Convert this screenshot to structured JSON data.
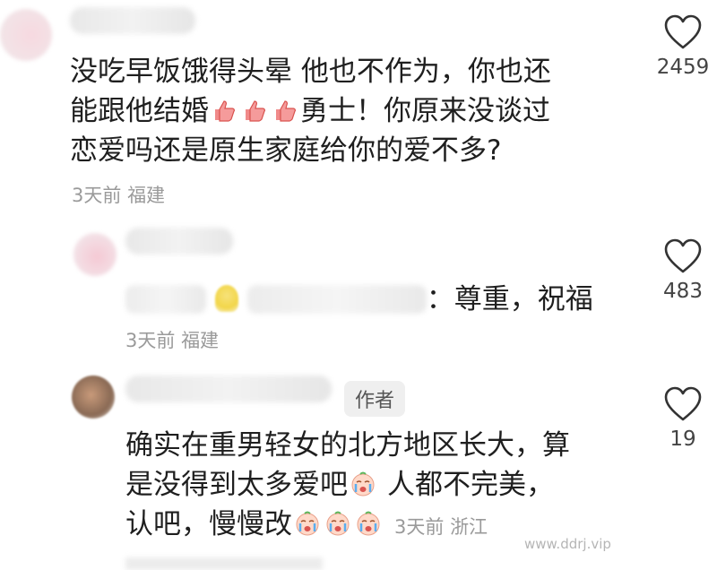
{
  "comments": [
    {
      "line1": "没吃早饭饿得头晕 他也不作为，你也还",
      "line2_a": "能跟他结婚",
      "line2_b": "勇士！你原来没谈过",
      "line3": "恋爱吗还是原生家庭给你的爱不多?",
      "time": "3天前",
      "location": "福建",
      "likes": "2459"
    },
    {
      "text_visible": "尊重，祝福",
      "text_visible_prefix": "：",
      "time": "3天前",
      "location": "福建",
      "likes": "483"
    },
    {
      "badge": "作者",
      "line1": "确实在重男轻女的北方地区长大，算",
      "line2_a": "是没得到太多爱吧",
      "line2_b": "人都不完美，",
      "line3": "认吧，慢慢改",
      "time": "3天前",
      "location": "浙江",
      "likes": "19"
    }
  ],
  "watermark": "www.ddrj.vip",
  "colors": {
    "text": "#1f1f1f",
    "meta": "#9a9a9a",
    "badge_bg": "#efefef"
  },
  "icons": {
    "like": "heart-outline-icon",
    "emoji_thumb": "thumbs-up-emoji-icon",
    "emoji_cry": "crying-face-emoji-icon"
  }
}
